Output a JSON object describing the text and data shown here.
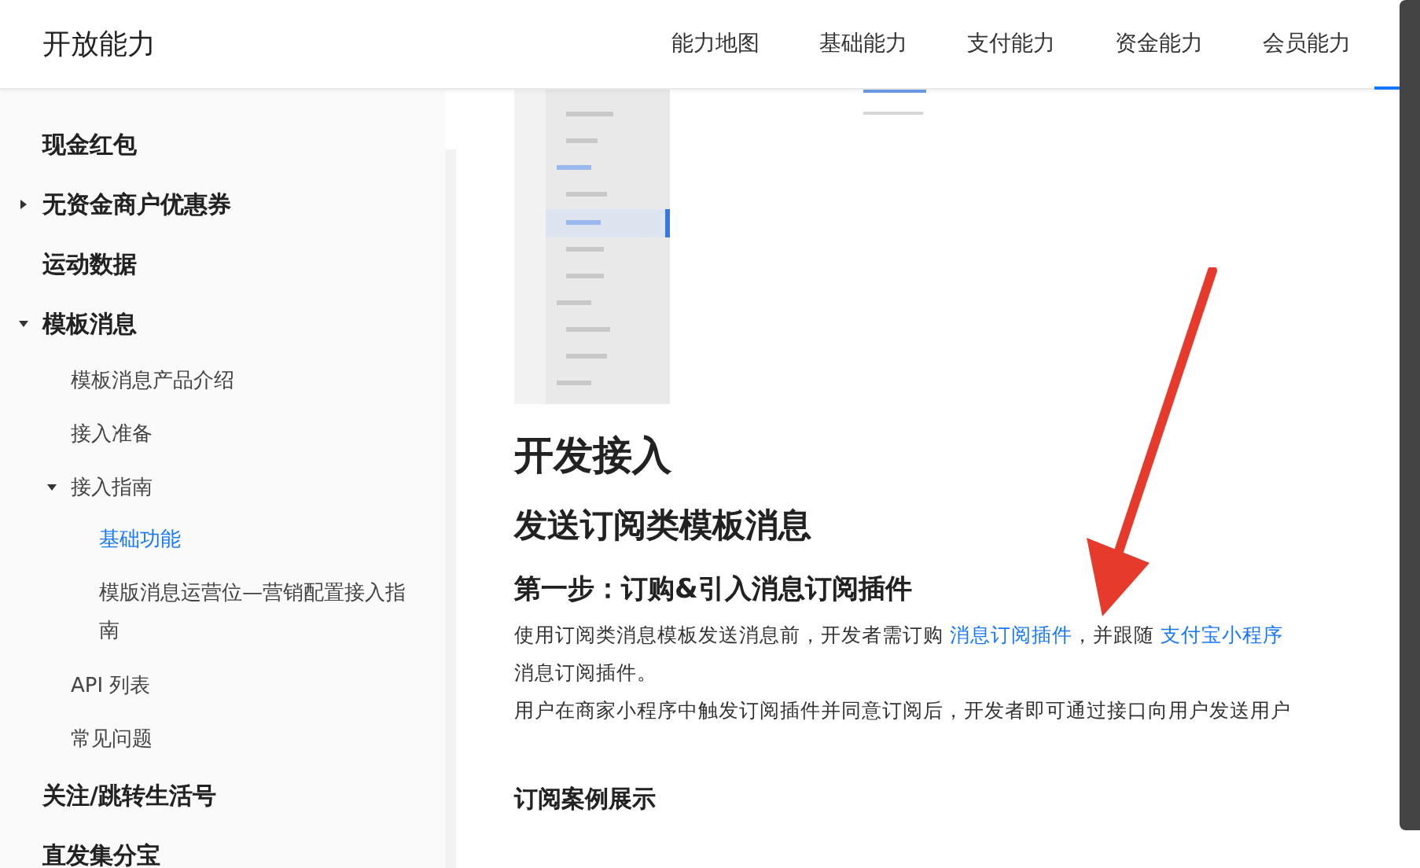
{
  "header": {
    "title": "开放能力",
    "tabs": [
      {
        "label": "能力地图",
        "selected": false
      },
      {
        "label": "基础能力",
        "selected": false
      },
      {
        "label": "支付能力",
        "selected": false
      },
      {
        "label": "资金能力",
        "selected": false
      },
      {
        "label": "会员能力",
        "selected": false
      }
    ]
  },
  "sidebar": {
    "items": [
      {
        "label": "现金红包",
        "selected": false
      },
      {
        "label": "无资金商户优惠券",
        "selected": false,
        "expanded": false
      },
      {
        "label": "运动数据",
        "selected": false
      },
      {
        "label": "模板消息",
        "selected": false,
        "expanded": true,
        "children": [
          {
            "label": "模板消息产品介绍",
            "selected": false
          },
          {
            "label": "接入准备",
            "selected": false
          },
          {
            "label": "接入指南",
            "selected": false,
            "expanded": true,
            "children": [
              {
                "label": "基础功能",
                "selected": true
              },
              {
                "label": "模版消息运营位—营销配置接入指南",
                "selected": false
              }
            ]
          },
          {
            "label": "API 列表",
            "selected": false
          },
          {
            "label": "常见问题",
            "selected": false
          }
        ]
      },
      {
        "label": "关注/跳转生活号",
        "selected": false
      },
      {
        "label": "直发集分宝",
        "selected": false
      }
    ]
  },
  "content": {
    "h1": "开发接入",
    "h2": "发送订阅类模板消息",
    "h3": "第一步：订购&引入消息订阅插件",
    "paragraph_lines": [
      [
        {
          "text": "使用订阅类消息模板发送消息前，开发者需订购 "
        },
        {
          "text": "消息订阅插件",
          "link": true
        },
        {
          "text": "，并跟随 "
        },
        {
          "text": "支付宝小程序",
          "link": true
        }
      ],
      [
        {
          "text": "消息订阅插件。"
        }
      ],
      [
        {
          "text": "用户在商家小程序中触发订阅插件并同意订阅后，开发者即可通过接口向用户发送用户"
        }
      ]
    ],
    "section_title": "订阅案例展示"
  }
}
